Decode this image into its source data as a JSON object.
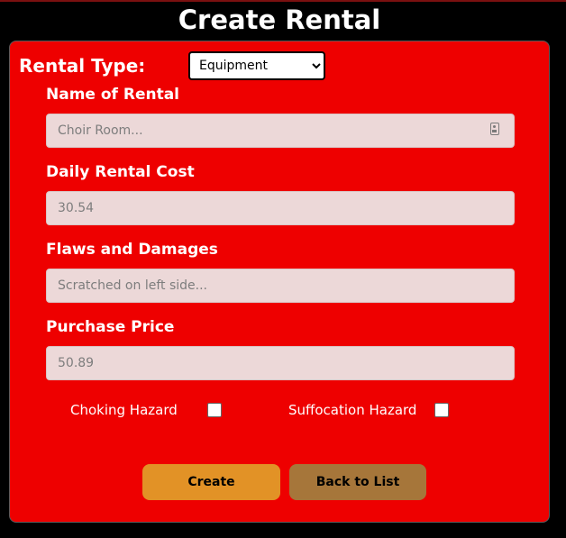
{
  "page": {
    "title": "Create Rental"
  },
  "form": {
    "rental_type_label": "Rental Type:",
    "rental_type_selected": "Equipment",
    "fields": [
      {
        "label": "Name of Rental",
        "value": "",
        "placeholder": "Choir Room..."
      },
      {
        "label": "Daily Rental Cost",
        "value": "",
        "placeholder": "30.54"
      },
      {
        "label": "Flaws and Damages",
        "value": "",
        "placeholder": "Scratched on left side..."
      },
      {
        "label": "Purchase Price",
        "value": "",
        "placeholder": "50.89"
      }
    ],
    "checkboxes": [
      {
        "label": "Choking Hazard",
        "checked": false
      },
      {
        "label": "Suffocation Hazard",
        "checked": false
      }
    ],
    "buttons": {
      "create": "Create",
      "back": "Back to List"
    }
  },
  "colors": {
    "background": "#000000",
    "card": "#ee0000",
    "input": "#ecd8d8",
    "create_button": "#e29226",
    "back_button": "#a6763a"
  },
  "icons": {
    "name_field_icon": "contact-card-icon",
    "select_arrow": "chevron-down-icon"
  }
}
